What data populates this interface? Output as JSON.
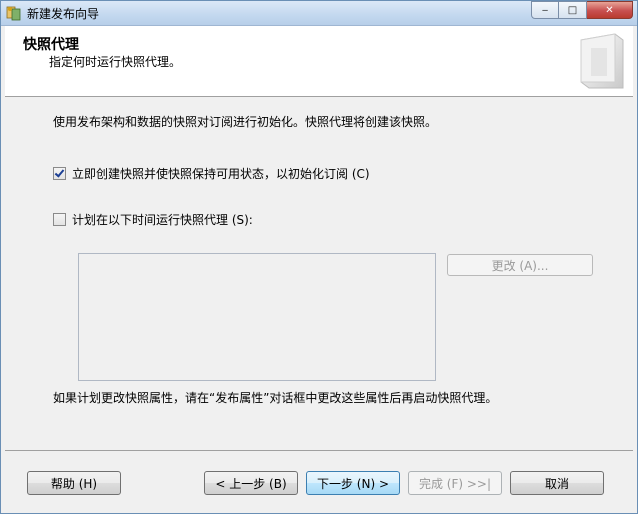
{
  "window": {
    "title": "新建发布向导",
    "minimize": "‒",
    "maximize": "□",
    "close": "✕"
  },
  "header": {
    "title": "快照代理",
    "subtitle": "指定何时运行快照代理。"
  },
  "main": {
    "intro": "使用发布架构和数据的快照对订阅进行初始化。快照代理将创建该快照。",
    "create_snapshot": {
      "label": "立即创建快照并使快照保持可用状态，以初始化订阅 (C)",
      "checked": true
    },
    "schedule": {
      "label": "计划在以下时间运行快照代理 (S):",
      "checked": false
    },
    "change_button": "更改 (A)...",
    "note": "如果计划更改快照属性，请在“发布属性”对话框中更改这些属性后再启动快照代理。"
  },
  "footer": {
    "help": "帮助 (H)",
    "back": "< 上一步 (B)",
    "next": "下一步 (N) >",
    "finish": "完成 (F) >>|",
    "cancel": "取消"
  }
}
